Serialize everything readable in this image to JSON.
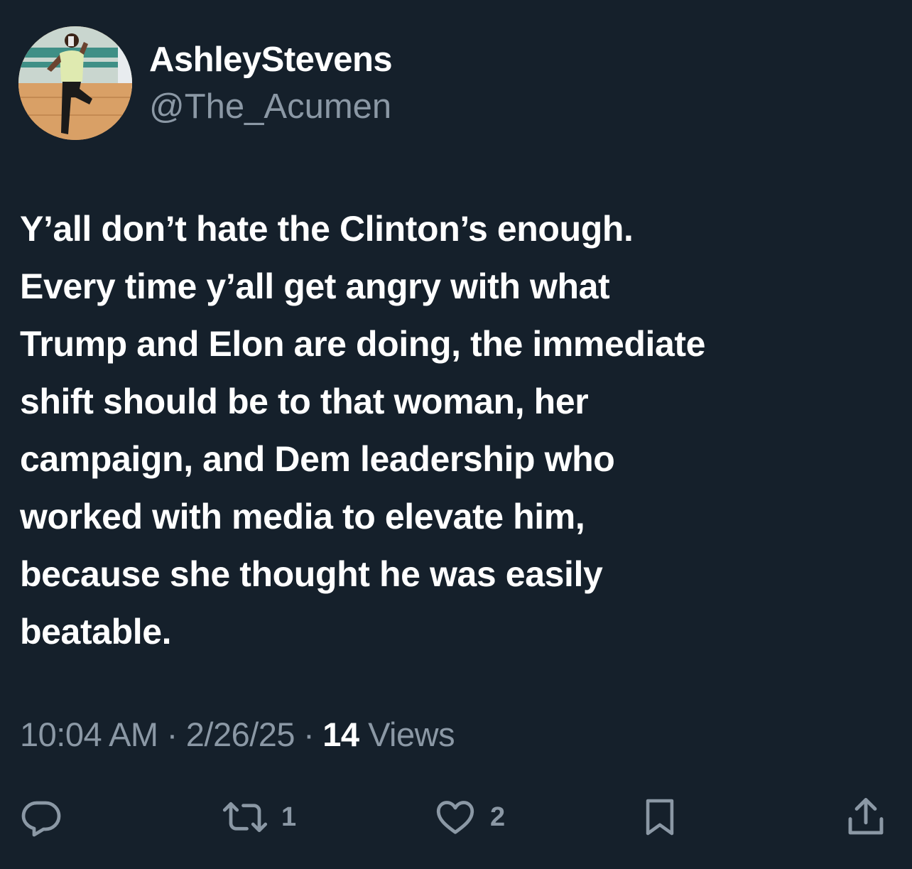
{
  "user": {
    "display_name": "AshleyStevens",
    "handle": "@The_Acumen",
    "avatar_icon": "profile-photo"
  },
  "tweet": {
    "lines": [
      "Y’all don’t hate the Clinton’s enough.",
      "Every time y’all get angry with what",
      "Trump and Elon are doing, the immediate",
      "shift should be to that woman, her",
      "campaign, and Dem leadership who",
      "worked with media to elevate him,",
      "because she thought he was easily",
      "beatable."
    ]
  },
  "meta": {
    "time": "10:04 AM",
    "separator": "·",
    "date": "2/26/25",
    "views_count": "14",
    "views_label": "Views"
  },
  "actions": {
    "reply": {
      "icon": "reply-icon"
    },
    "retweet": {
      "icon": "retweet-icon",
      "count": "1"
    },
    "like": {
      "icon": "heart-icon",
      "count": "2"
    },
    "bookmark": {
      "icon": "bookmark-icon"
    },
    "share": {
      "icon": "share-icon"
    }
  },
  "colors": {
    "background": "#15202b",
    "text_primary": "#ffffff",
    "text_secondary": "#8b98a5"
  }
}
